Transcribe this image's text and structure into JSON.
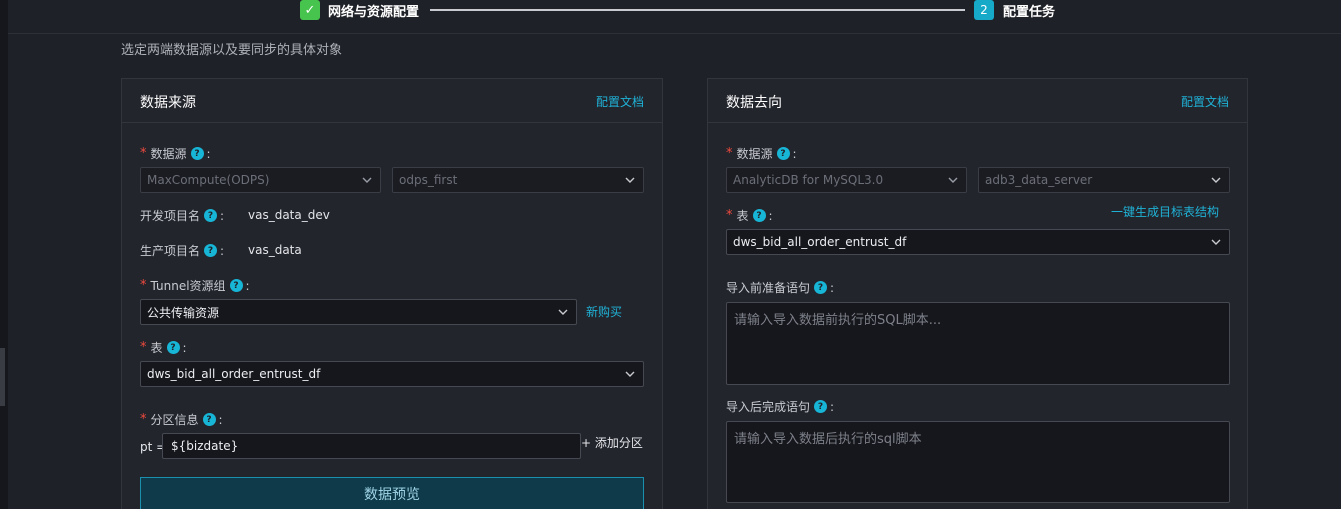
{
  "stepper": {
    "step1_label": "网络与资源配置",
    "step2_number": "2",
    "step2_label": "配置任务"
  },
  "subtitle": "选定两端数据源以及要同步的具体对象",
  "source": {
    "title": "数据来源",
    "doc_link": "配置文档",
    "datasource_label": "数据源",
    "datasource_type": "MaxCompute(ODPS)",
    "datasource_name": "odps_first",
    "dev_project_label": "开发项目名",
    "dev_project_value": "vas_data_dev",
    "prod_project_label": "生产项目名",
    "prod_project_value": "vas_data",
    "tunnel_label": "Tunnel资源组",
    "tunnel_value": "公共传输资源",
    "tunnel_buy": "新购买",
    "table_label": "表",
    "table_value": "dws_bid_all_order_entrust_df",
    "partition_label": "分区信息",
    "partition_key": "pt =",
    "partition_value": "${bizdate}",
    "add_partition": "+ 添加分区",
    "preview_button": "数据预览"
  },
  "target": {
    "title": "数据去向",
    "doc_link": "配置文档",
    "datasource_label": "数据源",
    "datasource_type": "AnalyticDB for MySQL3.0",
    "datasource_name": "adb3_data_server",
    "table_label": "表",
    "generate_link": "一键生成目标表结构",
    "table_value": "dws_bid_all_order_entrust_df",
    "pre_sql_label": "导入前准备语句",
    "pre_sql_placeholder": "请输入导入数据前执行的SQL脚本...",
    "post_sql_label": "导入后完成语句",
    "post_sql_placeholder": "请输入导入数据后执行的sql脚本"
  },
  "icons": {
    "help": "question-circle-icon",
    "dropdown": "chevron-down-icon",
    "step_done": "check-icon"
  },
  "colors": {
    "accent": "#1fb2d6",
    "step_done": "#46c44d",
    "step_active": "#17a9c8",
    "required": "#f04a3e"
  }
}
